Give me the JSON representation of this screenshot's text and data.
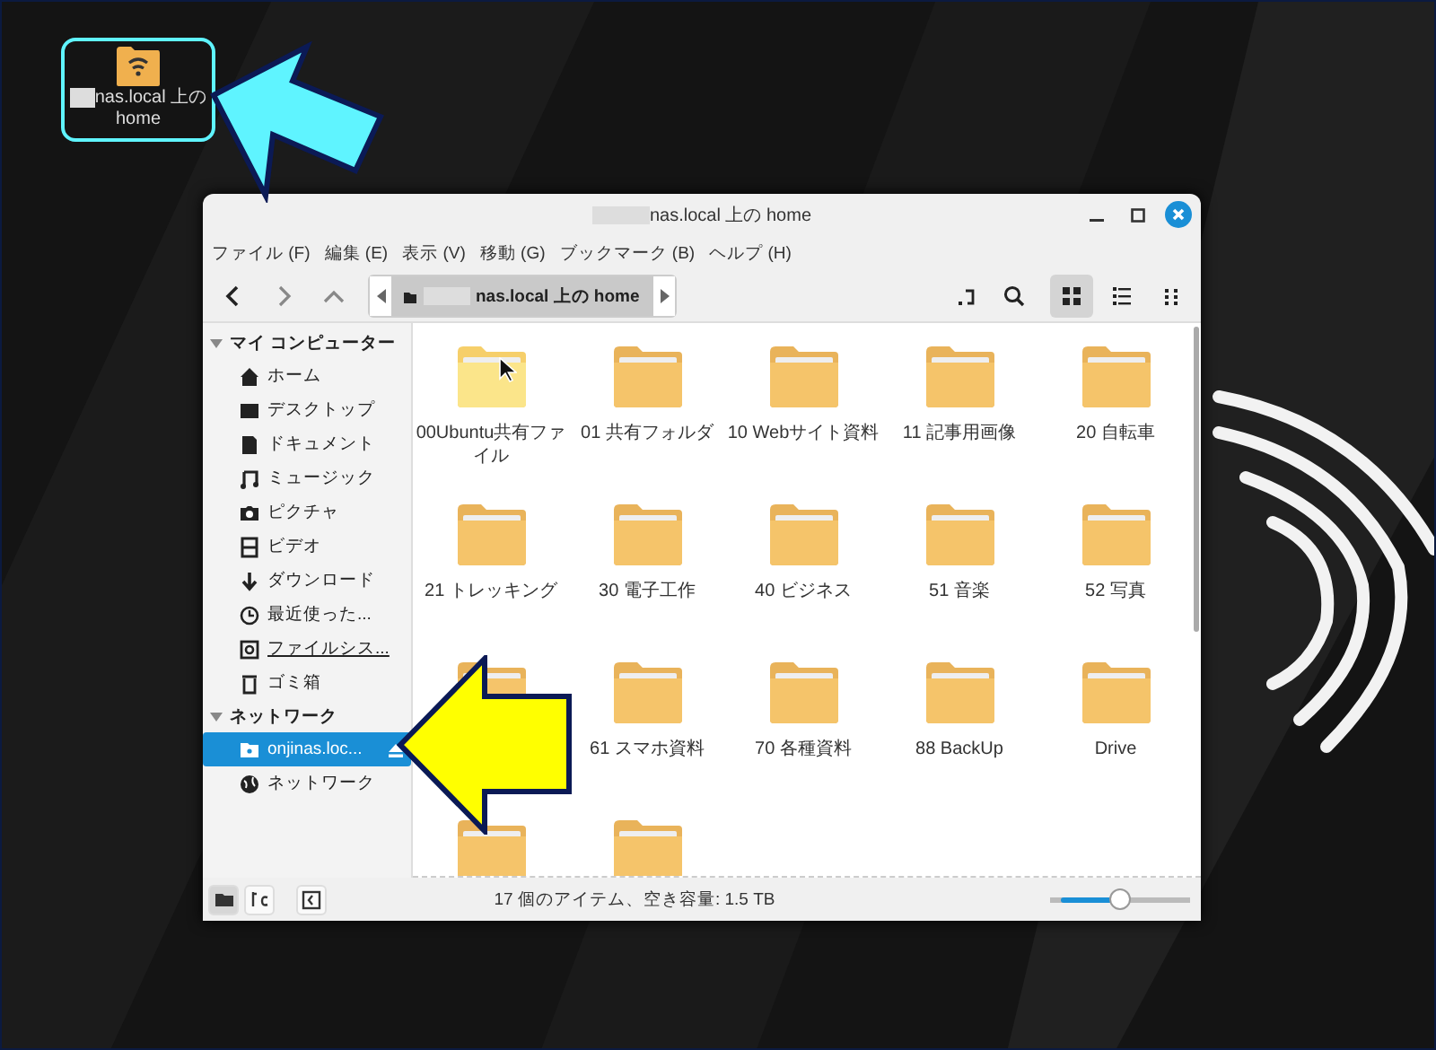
{
  "desktop_icon": {
    "label_line_1": "nas.local 上の",
    "label_line_2": "home",
    "selected": true
  },
  "window": {
    "title": "nas.local 上の home"
  },
  "menu": [
    "ファイル (F)",
    "編集 (E)",
    "表示 (V)",
    "移動 (G)",
    "ブックマーク (B)",
    "ヘルプ (H)"
  ],
  "location": {
    "path": "nas.local 上の home"
  },
  "view_buttons": [
    {
      "kind": "grid",
      "selected": true
    },
    {
      "kind": "list",
      "selected": false
    },
    {
      "kind": "compact",
      "selected": false
    }
  ],
  "sidebar": {
    "sections": [
      {
        "title": "マイ コンピューター",
        "expanded": true,
        "items": [
          {
            "label": "ホーム",
            "selected": false,
            "underlined": false,
            "ejectable": false
          },
          {
            "label": "デスクトップ",
            "selected": false,
            "underlined": false,
            "ejectable": false
          },
          {
            "label": "ドキュメント",
            "selected": false,
            "underlined": false,
            "ejectable": false
          },
          {
            "label": "ミュージック",
            "selected": false,
            "underlined": false,
            "ejectable": false
          },
          {
            "label": "ピクチャ",
            "selected": false,
            "underlined": false,
            "ejectable": false
          },
          {
            "label": "ビデオ",
            "selected": false,
            "underlined": false,
            "ejectable": false
          },
          {
            "label": "ダウンロード",
            "selected": false,
            "underlined": false,
            "ejectable": false
          },
          {
            "label": "最近使った...",
            "selected": false,
            "underlined": false,
            "ejectable": false
          },
          {
            "label": "ファイルシス...",
            "selected": false,
            "underlined": true,
            "ejectable": false
          },
          {
            "label": "ゴミ箱",
            "selected": false,
            "underlined": false,
            "ejectable": false
          }
        ]
      },
      {
        "title": "ネットワーク",
        "expanded": true,
        "items": [
          {
            "label": "onjinas.loc...",
            "selected": true,
            "underlined": false,
            "ejectable": true
          },
          {
            "label": "ネットワーク",
            "selected": false,
            "underlined": false,
            "ejectable": false
          }
        ]
      }
    ]
  },
  "files": [
    {
      "name": "00Ubuntu共有ファイル",
      "hovered": true
    },
    {
      "name": "01 共有フォルダ",
      "hovered": false
    },
    {
      "name": "10 Webサイト資料",
      "hovered": false
    },
    {
      "name": "11 記事用画像",
      "hovered": false
    },
    {
      "name": "20 自転車",
      "hovered": false
    },
    {
      "name": "21 トレッキング",
      "hovered": false
    },
    {
      "name": "30 電子工作",
      "hovered": false
    },
    {
      "name": "40 ビジネス",
      "hovered": false
    },
    {
      "name": "51 音楽",
      "hovered": false
    },
    {
      "name": "52 写真",
      "hovered": false
    },
    {
      "hovered": false
    },
    {
      "name": "61 スマホ資料",
      "hovered": false
    },
    {
      "name": "70 各種資料",
      "hovered": false
    },
    {
      "name": "88 BackUp",
      "hovered": false
    },
    {
      "name": "Drive",
      "hovered": false
    },
    {
      "hovered": false
    },
    {
      "hovered": false
    }
  ],
  "status_bar": {
    "buttons": [
      {
        "kind": "places",
        "selected": true
      },
      {
        "kind": "tree",
        "selected": false
      }
    ],
    "text": "17 個のアイテム、空き容量: 1.5 TB",
    "zoom": {
      "level": 0.5
    }
  }
}
